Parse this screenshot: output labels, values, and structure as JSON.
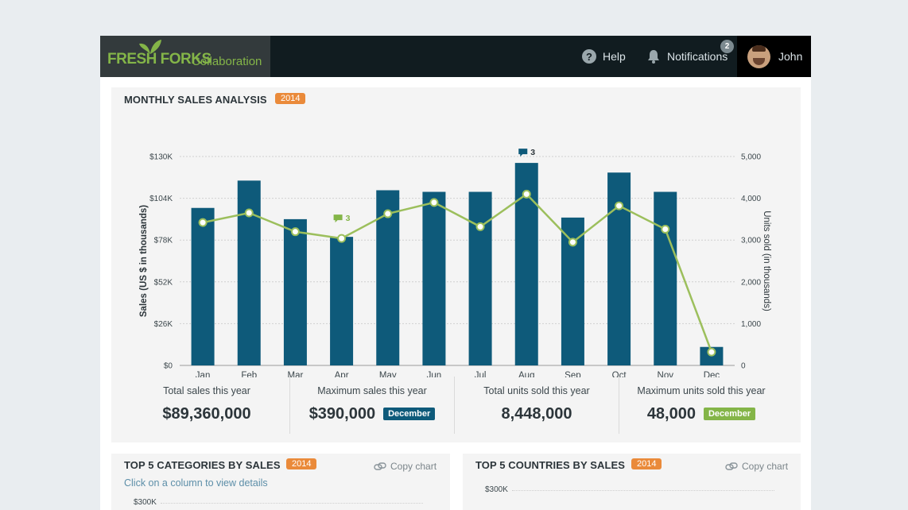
{
  "header": {
    "brand_name": "FRESH FORKS",
    "brand_sub": "Collaboration",
    "help_label": "Help",
    "notifications_label": "Notifications",
    "notifications_count": "2",
    "user_name": "John"
  },
  "main_panel": {
    "title": "MONTHLY SALES ANALYSIS",
    "year": "2014",
    "stats": [
      {
        "label": "Total sales this year",
        "value": "$89,360,000",
        "tag": ""
      },
      {
        "label": "Maximum sales this year",
        "value": "$390,000",
        "tag": "December"
      },
      {
        "label": "Total units sold this year",
        "value": "8,448,000",
        "tag": ""
      },
      {
        "label": "Maximum units sold this year",
        "value": "48,000",
        "tag": "December"
      }
    ]
  },
  "categories_panel": {
    "title": "TOP 5 CATEGORIES BY SALES",
    "year": "2014",
    "copy_label": "Copy chart",
    "subtitle": "Click on a column to view details",
    "top_tick": "$300K"
  },
  "countries_panel": {
    "title": "TOP 5 COUNTRIES BY SALES",
    "year": "2014",
    "copy_label": "Copy chart",
    "top_tick": "$300K"
  },
  "chart_data": {
    "type": "bar",
    "categories": [
      "Jan",
      "Feb",
      "Mar",
      "Apr",
      "May",
      "Jun",
      "Jul",
      "Aug",
      "Sep",
      "Oct",
      "Nov",
      "Dec"
    ],
    "series": [
      {
        "name": "Sales",
        "type": "bar",
        "axis": "left",
        "values": [
          98000,
          115000,
          91000,
          80000,
          109000,
          108000,
          108000,
          126000,
          92000,
          120000,
          108000,
          11500
        ]
      },
      {
        "name": "Units Sold",
        "type": "line",
        "axis": "right",
        "values": [
          3420,
          3650,
          3200,
          3040,
          3630,
          3900,
          3320,
          4100,
          2950,
          3820,
          3260,
          320
        ]
      }
    ],
    "yleft": {
      "label": "Sales (US $ in thousands)",
      "ticks": [
        "$0",
        "$26K",
        "$52K",
        "$78K",
        "$104K",
        "$130K"
      ],
      "range": [
        0,
        130000
      ]
    },
    "yright": {
      "label": "Units sold (in thousands)",
      "ticks": [
        "0",
        "1,000",
        "2,000",
        "3,000",
        "4,000",
        "5,000"
      ],
      "range": [
        0,
        5000
      ]
    },
    "annotations": [
      {
        "category": "Apr",
        "text": "3",
        "color": "#84b548"
      },
      {
        "category": "Aug",
        "text": "3",
        "color": "#0e5a7a"
      }
    ],
    "legend": {
      "position": "bottom",
      "items": [
        "Sales",
        "Units Sold"
      ]
    },
    "grid": true,
    "colors": {
      "bar": "#0e5a7a",
      "line": "#9cbf5c",
      "tag_blue": "#0e5a7a",
      "tag_green": "#84b548",
      "year_badge": "#ea8a3a"
    }
  }
}
